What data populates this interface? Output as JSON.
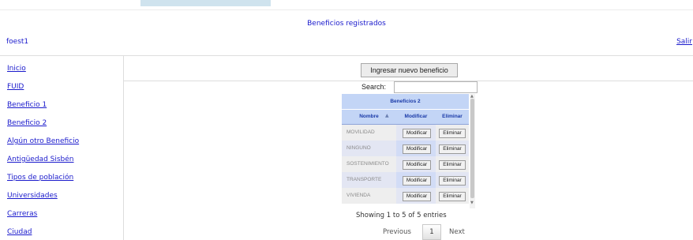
{
  "header": {
    "title": "Beneficios registrados",
    "user": "foest1",
    "logout": "Salir"
  },
  "sidebar": {
    "items": [
      {
        "label": "Inicio"
      },
      {
        "label": "FUID"
      },
      {
        "label": "Beneficio 1"
      },
      {
        "label": "Beneficio 2"
      },
      {
        "label": "Algún otro Beneficio"
      },
      {
        "label": "Antigüedad Sisbén"
      },
      {
        "label": "Tipos de población"
      },
      {
        "label": "Universidades"
      },
      {
        "label": "Carreras"
      },
      {
        "label": "Ciudad"
      }
    ]
  },
  "main": {
    "new_button": "Ingresar nuevo beneficio",
    "search_label": "Search:",
    "search_value": ""
  },
  "table": {
    "caption": "Beneficios 2",
    "columns": [
      "Nombre",
      "Modificar",
      "Eliminar"
    ],
    "rows": [
      {
        "name": "MOVILIDAD",
        "modify": "Modificar",
        "delete": "Eliminar"
      },
      {
        "name": "NINGUNO",
        "modify": "Modificar",
        "delete": "Eliminar"
      },
      {
        "name": "SOSTENIMIENTO",
        "modify": "Modificar",
        "delete": "Eliminar"
      },
      {
        "name": "TRANSPORTE",
        "modify": "Modificar",
        "delete": "Eliminar"
      },
      {
        "name": "VIVIENDA",
        "modify": "Modificar",
        "delete": "Eliminar"
      }
    ]
  },
  "pagination": {
    "info": "Showing 1 to 5 of 5 entries",
    "previous": "Previous",
    "current": "1",
    "next": "Next"
  },
  "colors": {
    "link": "#1a1acc",
    "table_header": "#c3d5f6",
    "row_even": "#eeeeee",
    "row_odd": "#e3e6f3",
    "highlight": "#d2dcf6"
  }
}
